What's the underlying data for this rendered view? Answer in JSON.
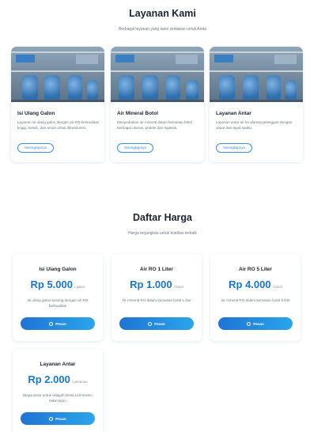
{
  "services": {
    "title": "Layanan Kami",
    "subtitle": "Berbagai layanan yang kami sediakan untuk Anda",
    "items": [
      {
        "name": "Isi Ulang Galon",
        "desc": "Layanan isi ulang galon dengan air RO berkualitas tinggi, bersih, dan aman untuk dikonsumsi.",
        "button": "Selengkapnya"
      },
      {
        "name": "Air Mineral Botol",
        "desc": "Menyediakan air mineral dalam kemasan botol berbagai ukuran, praktis dan higienis.",
        "button": "Selengkapnya"
      },
      {
        "name": "Layanan Antar",
        "desc": "Layanan antar air ke alamat pelanggan dengan cepat dan tepat waktu.",
        "button": "Selengkapnya"
      }
    ]
  },
  "pricing": {
    "title": "Daftar Harga",
    "subtitle": "Harga terjangkau untuk kualitas terbaik",
    "items": [
      {
        "name": "Isi Ulang Galon",
        "price": "Rp 5.000",
        "unit": "/ galon",
        "desc": "Isi ulang galon kosong dengan air RO berkualitas",
        "button": "Pesan"
      },
      {
        "name": "Air RO 1 Liter",
        "price": "Rp 1.000",
        "unit": "/ botol",
        "desc": "Air mineral RO dalam kemasan botol 1 liter",
        "button": "Pesan"
      },
      {
        "name": "Air RO 5 Liter",
        "price": "Rp 4.000",
        "unit": "/ botol",
        "desc": "Air mineral RO dalam kemasan botol 5 liter",
        "button": "Pesan"
      },
      {
        "name": "Layanan Antar",
        "price": "Rp 2.000",
        "unit": "/ pesanan",
        "desc": "Biaya antar untuk wilayah Desa Lirimowinu Nike'otano",
        "button": "Pesan"
      }
    ]
  }
}
